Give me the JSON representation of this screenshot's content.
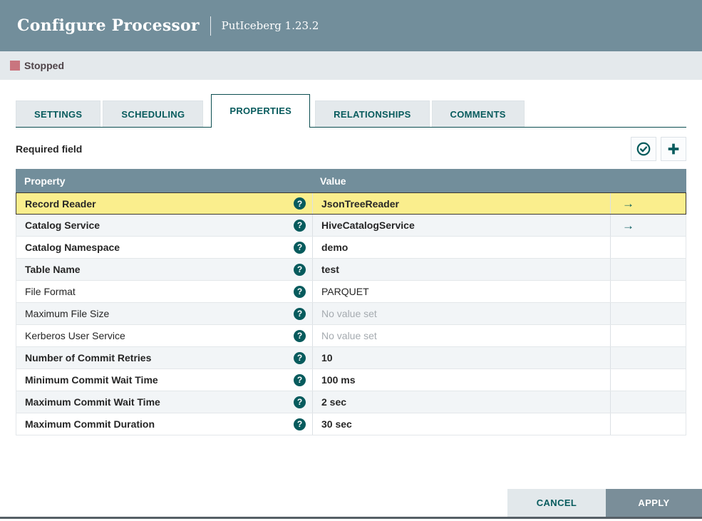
{
  "header": {
    "title": "Configure Processor",
    "subtitle": "PutIceberg 1.23.2"
  },
  "status": {
    "label": "Stopped",
    "color": "#C9757F"
  },
  "tabs": [
    {
      "label": "SETTINGS",
      "active": false
    },
    {
      "label": "SCHEDULING",
      "active": false
    },
    {
      "label": "PROPERTIES",
      "active": true
    },
    {
      "label": "RELATIONSHIPS",
      "active": false
    },
    {
      "label": "COMMENTS",
      "active": false
    }
  ],
  "toolbar": {
    "required_label": "Required field",
    "buttons": [
      {
        "name": "verify-properties-button",
        "icon": "check-circle-icon"
      },
      {
        "name": "add-property-button",
        "icon": "plus-icon"
      }
    ]
  },
  "icons": {
    "help": "?",
    "goto_arrow": "→"
  },
  "table": {
    "columns": [
      "Property",
      "Value"
    ],
    "rows": [
      {
        "property": "Record Reader",
        "required": true,
        "value": "JsonTreeReader",
        "unset": false,
        "link": true,
        "selected": true
      },
      {
        "property": "Catalog Service",
        "required": true,
        "value": "HiveCatalogService",
        "unset": false,
        "link": true,
        "selected": false
      },
      {
        "property": "Catalog Namespace",
        "required": true,
        "value": "demo",
        "unset": false,
        "link": false,
        "selected": false
      },
      {
        "property": "Table Name",
        "required": true,
        "value": "test",
        "unset": false,
        "link": false,
        "selected": false
      },
      {
        "property": "File Format",
        "required": false,
        "value": "PARQUET",
        "unset": false,
        "link": false,
        "selected": false
      },
      {
        "property": "Maximum File Size",
        "required": false,
        "value": "No value set",
        "unset": true,
        "link": false,
        "selected": false
      },
      {
        "property": "Kerberos User Service",
        "required": false,
        "value": "No value set",
        "unset": true,
        "link": false,
        "selected": false
      },
      {
        "property": "Number of Commit Retries",
        "required": true,
        "value": "10",
        "unset": false,
        "link": false,
        "selected": false
      },
      {
        "property": "Minimum Commit Wait Time",
        "required": true,
        "value": "100 ms",
        "unset": false,
        "link": false,
        "selected": false
      },
      {
        "property": "Maximum Commit Wait Time",
        "required": true,
        "value": "2 sec",
        "unset": false,
        "link": false,
        "selected": false
      },
      {
        "property": "Maximum Commit Duration",
        "required": true,
        "value": "30 sec",
        "unset": false,
        "link": false,
        "selected": false
      }
    ]
  },
  "footer": {
    "cancel_label": "CANCEL",
    "apply_label": "APPLY"
  },
  "colors": {
    "header_bg": "#728E9B",
    "accent_teal": "#075B5D",
    "selected_row": "#FAEE8D",
    "stopped_red": "#C9757F",
    "row_stripe": "#F2F5F7",
    "tab_border": "#0B4D50"
  }
}
